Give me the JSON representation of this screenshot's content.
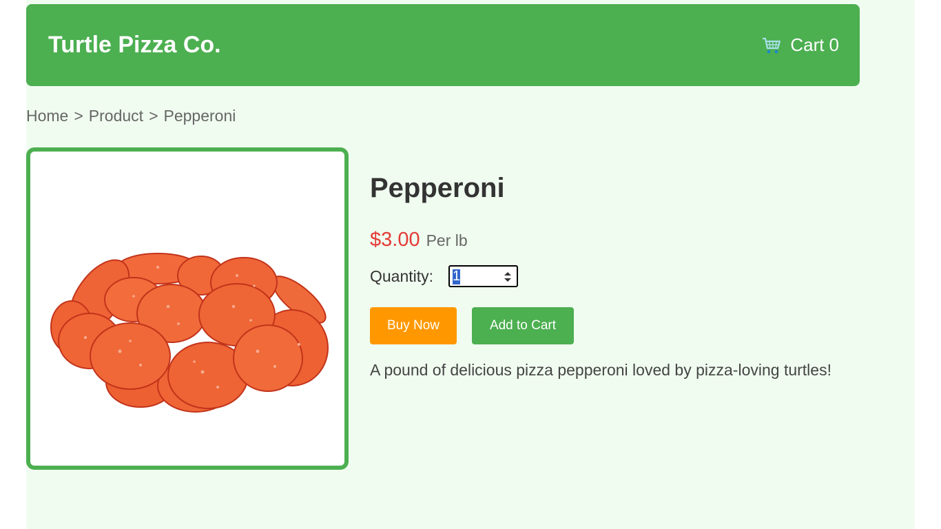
{
  "header": {
    "brand": "Turtle Pizza Co.",
    "cart_label": "Cart",
    "cart_count": "0",
    "cart_icon": "shopping-cart-icon"
  },
  "breadcrumb": {
    "items": [
      "Home",
      "Product",
      "Pepperoni"
    ],
    "separator": ">"
  },
  "product": {
    "name": "Pepperoni",
    "image_icon": "pepperoni-image",
    "price": "$3.00",
    "unit": "Per lb",
    "quantity_label": "Quantity:",
    "quantity_value": "1",
    "buy_now_label": "Buy Now",
    "add_to_cart_label": "Add to Cart",
    "description": "A pound of delicious pizza pepperoni loved by pizza-loving turtles!"
  },
  "colors": {
    "brand_green": "#4caf50",
    "background": "#f0fcf0",
    "price_red": "#e53935",
    "buy_orange": "#ff9800"
  }
}
